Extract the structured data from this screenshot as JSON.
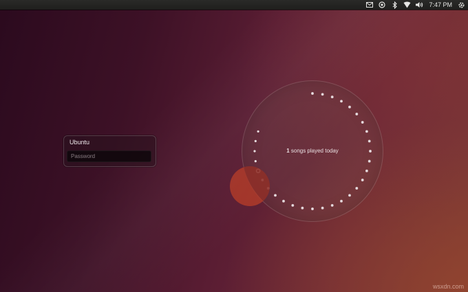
{
  "top_panel": {
    "indicators": [
      {
        "icon": "mail-icon"
      },
      {
        "icon": "session-icon"
      },
      {
        "icon": "bluetooth-icon"
      },
      {
        "icon": "network-icon"
      },
      {
        "icon": "volume-icon"
      }
    ],
    "clock": "7:47 PM",
    "power_icon": "power-icon"
  },
  "login": {
    "user_name": "Ubuntu",
    "password_placeholder": "Password"
  },
  "music_circle": {
    "count": "1",
    "label": " songs played today",
    "ring_dot_count": 36,
    "active_dot_fraction": 0.69
  },
  "watermark": "wsxdn.com",
  "colors": {
    "panel": "#222220",
    "accent": "#b23c2a",
    "wallpaper_dark": "#2b0a1e",
    "wallpaper_light": "#7a3a36"
  }
}
